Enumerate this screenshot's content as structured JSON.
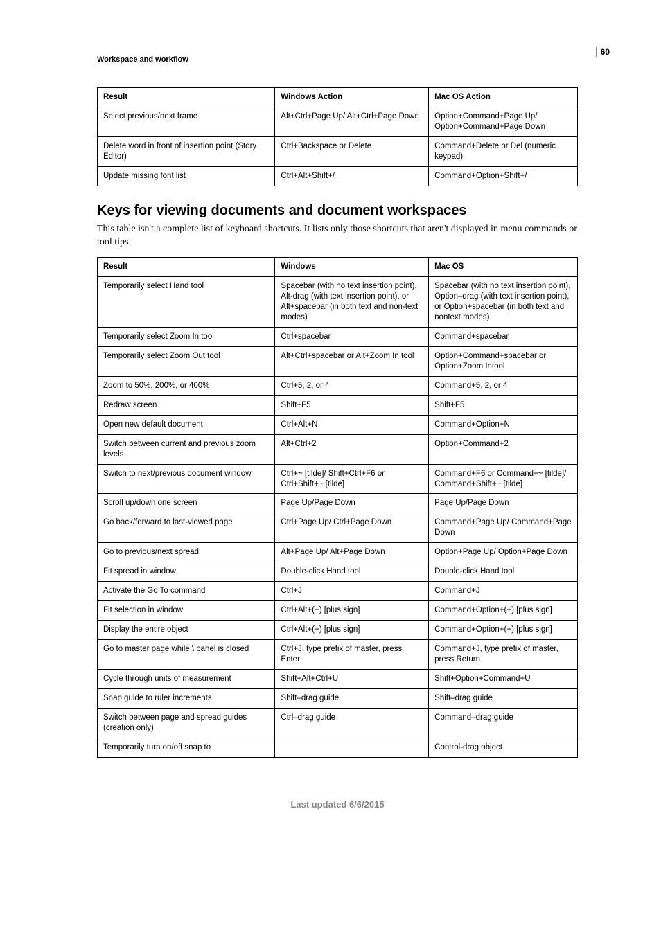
{
  "page_number": "60",
  "section_label": "Workspace and workflow",
  "table1": {
    "headers": {
      "result": "Result",
      "win": "Windows Action",
      "mac": "Mac OS Action"
    },
    "rows": [
      {
        "result": "Select previous/next frame",
        "win": "Alt+Ctrl+Page Up/ Alt+Ctrl+Page Down",
        "mac": "Option+Command+Page Up/ Option+Command+Page Down"
      },
      {
        "result": "Delete word in front of insertion point (Story Editor)",
        "win": "Ctrl+Backspace or Delete",
        "mac": "Command+Delete or Del (numeric keypad)"
      },
      {
        "result": "Update missing font list",
        "win": "Ctrl+Alt+Shift+/",
        "mac": "Command+Option+Shift+/"
      }
    ]
  },
  "heading": "Keys for viewing documents and document workspaces",
  "intro": "This table isn't a complete list of keyboard shortcuts. It lists only those shortcuts that aren't displayed in menu commands or tool tips.",
  "table2": {
    "headers": {
      "result": "Result",
      "win": "Windows",
      "mac": "Mac OS"
    },
    "rows": [
      {
        "result": "Temporarily select Hand tool",
        "win": "Spacebar (with no text insertion point), Alt-drag (with text insertion point), or Alt+spacebar (in both text and non-text modes)",
        "mac": "Spacebar (with no text insertion point), Option–drag (with text insertion point), or Option+spacebar (in both text and nontext modes)"
      },
      {
        "result": "Temporarily select Zoom In tool",
        "win": "Ctrl+spacebar",
        "mac": "Command+spacebar"
      },
      {
        "result": "Temporarily select Zoom Out tool",
        "win": "Alt+Ctrl+spacebar or Alt+Zoom In tool",
        "mac": "Option+Command+spacebar or Option+Zoom Intool"
      },
      {
        "result": "Zoom to 50%, 200%, or 400%",
        "win": "Ctrl+5, 2, or 4",
        "mac": "Command+5, 2, or 4"
      },
      {
        "result": "Redraw screen",
        "win": "Shift+F5",
        "mac": "Shift+F5"
      },
      {
        "result": "Open new default document",
        "win": "Ctrl+Alt+N",
        "mac": "Command+Option+N"
      },
      {
        "result": "Switch between current and previous zoom levels",
        "win": "Alt+Ctrl+2",
        "mac": "Option+Command+2"
      },
      {
        "result": "Switch to next/previous document window",
        "win": "Ctrl+~ [tilde]/ Shift+Ctrl+F6 or Ctrl+Shift+~ [tilde]",
        "mac": "Command+F6 or Command+~ [tilde]/ Command+Shift+~ [tilde]"
      },
      {
        "result": "Scroll up/down one screen",
        "win": "Page Up/Page Down",
        "mac": "Page Up/Page Down"
      },
      {
        "result": "Go back/forward to last-viewed page",
        "win": "Ctrl+Page Up/ Ctrl+Page Down",
        "mac": "Command+Page Up/ Command+Page Down"
      },
      {
        "result": "Go to previous/next spread",
        "win": "Alt+Page Up/ Alt+Page Down",
        "mac": "Option+Page Up/ Option+Page Down"
      },
      {
        "result": "Fit spread in window",
        "win": "Double-click Hand tool",
        "mac": "Double-click Hand tool"
      },
      {
        "result": "Activate the Go To command",
        "win": "Ctrl+J",
        "mac": "Command+J"
      },
      {
        "result": "Fit selection in window",
        "win": "Ctrl+Alt+(+) [plus sign]",
        "mac": "Command+Option+(+) [plus sign]"
      },
      {
        "result": "Display the entire object",
        "win": "Ctrl+Alt+(+) [plus sign]",
        "mac": "Command+Option+(+) [plus sign]"
      },
      {
        "result": "Go to master page while \\ panel is closed",
        "win": "Ctrl+J, type prefix of master, press Enter",
        "mac": "Command+J, type prefix of master, press Return"
      },
      {
        "result": "Cycle through units of measurement",
        "win": "Shift+Alt+Ctrl+U",
        "mac": "Shift+Option+Command+U"
      },
      {
        "result": "Snap guide to ruler increments",
        "win": "Shift–drag guide",
        "mac": "Shift–drag guide"
      },
      {
        "result": "Switch between page and spread guides (creation only)",
        "win": "Ctrl–drag guide",
        "mac": "Command–drag guide"
      },
      {
        "result": "Temporarily turn on/off snap to",
        "win": "",
        "mac": "Control-drag object"
      }
    ]
  },
  "footer": "Last updated 6/6/2015"
}
